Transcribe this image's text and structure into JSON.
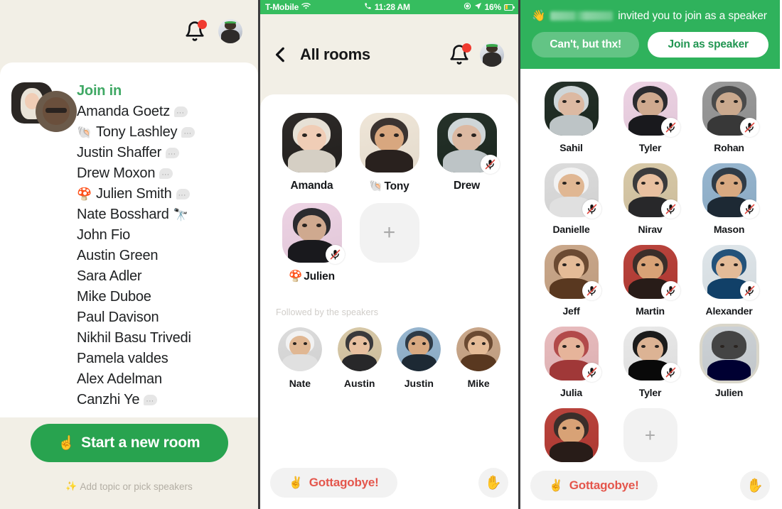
{
  "left_panel": {
    "header": {
      "notifications_icon": "bell-icon",
      "has_unread_badge": true,
      "profile_icon": "user-avatar"
    },
    "room_card": {
      "join_label": "Join in",
      "people": [
        {
          "emoji": "",
          "name": "Amanda Goetz",
          "has_bubble": true,
          "trailing_emoji": ""
        },
        {
          "emoji": "🐚",
          "name": "Tony Lashley",
          "has_bubble": true,
          "trailing_emoji": ""
        },
        {
          "emoji": "",
          "name": "Justin Shaffer",
          "has_bubble": true,
          "trailing_emoji": ""
        },
        {
          "emoji": "",
          "name": "Drew Moxon",
          "has_bubble": true,
          "trailing_emoji": ""
        },
        {
          "emoji": "🍄",
          "name": "Julien Smith",
          "has_bubble": true,
          "trailing_emoji": ""
        },
        {
          "emoji": "",
          "name": "Nate Bosshard",
          "has_bubble": false,
          "trailing_emoji": "🔭"
        },
        {
          "emoji": "",
          "name": "John Fio",
          "has_bubble": false,
          "trailing_emoji": ""
        },
        {
          "emoji": "",
          "name": "Austin Green",
          "has_bubble": false,
          "trailing_emoji": ""
        },
        {
          "emoji": "",
          "name": "Sara Adler",
          "has_bubble": false,
          "trailing_emoji": ""
        },
        {
          "emoji": "",
          "name": "Mike Duboe",
          "has_bubble": false,
          "trailing_emoji": ""
        },
        {
          "emoji": "",
          "name": "Paul Davison",
          "has_bubble": false,
          "trailing_emoji": ""
        },
        {
          "emoji": "",
          "name": "Nikhil Basu Trivedi",
          "has_bubble": false,
          "trailing_emoji": ""
        },
        {
          "emoji": "",
          "name": "Pamela valdes",
          "has_bubble": false,
          "trailing_emoji": ""
        },
        {
          "emoji": "",
          "name": "Alex Adelman",
          "has_bubble": false,
          "trailing_emoji": ""
        },
        {
          "emoji": "",
          "name": "Canzhi Ye",
          "has_bubble": true,
          "trailing_emoji": ""
        }
      ]
    },
    "footer": {
      "start_room_emoji": "☝️",
      "start_room_label": "Start a new room",
      "hint_spark": "✨",
      "hint_label": "Add topic or pick speakers"
    }
  },
  "mid_panel": {
    "status_bar": {
      "carrier": "T-Mobile",
      "wifi_icon": "wifi-icon",
      "call_icon": "phone-icon",
      "time": "11:28 AM",
      "record_icon": "screen-record-icon",
      "location_icon": "location-arrow-icon",
      "battery_percent": "16%",
      "battery_icon": "battery-low-icon"
    },
    "header": {
      "back_icon": "chevron-left-icon",
      "title": "All rooms",
      "notifications_icon": "bell-icon",
      "profile_icon": "user-avatar"
    },
    "speakers": [
      {
        "name": "Amanda",
        "emoji": "",
        "muted": false
      },
      {
        "name": "Tony",
        "emoji": "🐚",
        "muted": false
      },
      {
        "name": "Drew",
        "emoji": "",
        "muted": true
      },
      {
        "name": "Julien",
        "emoji": "🍄",
        "muted": true
      }
    ],
    "add_speaker_label": "+",
    "followed_label": "Followed by the speakers",
    "followers": [
      {
        "name": "Nate"
      },
      {
        "name": "Austin"
      },
      {
        "name": "Justin"
      },
      {
        "name": "Mike"
      }
    ],
    "footer": {
      "leave_emoji": "✌️",
      "leave_label": "Gottagobye!",
      "hand_emoji": "✋"
    }
  },
  "right_panel": {
    "invite_banner": {
      "wave_emoji": "👋",
      "redacted_name": "",
      "message": "invited you to join as a speaker",
      "decline_label": "Can't, but thx!",
      "accept_label": "Join as speaker"
    },
    "participants": [
      {
        "name": "Sahil",
        "muted": false,
        "speaking": false
      },
      {
        "name": "Tyler",
        "muted": true,
        "speaking": false
      },
      {
        "name": "Rohan",
        "muted": true,
        "speaking": false
      },
      {
        "name": "Danielle",
        "muted": true,
        "speaking": false
      },
      {
        "name": "Nirav",
        "muted": true,
        "speaking": false
      },
      {
        "name": "Mason",
        "muted": true,
        "speaking": false
      },
      {
        "name": "Jeff",
        "muted": true,
        "speaking": false
      },
      {
        "name": "Martin",
        "muted": true,
        "speaking": false
      },
      {
        "name": "Alexander",
        "muted": true,
        "speaking": false
      },
      {
        "name": "Julia",
        "muted": true,
        "speaking": false
      },
      {
        "name": "Tyler",
        "muted": true,
        "speaking": false
      },
      {
        "name": "Julien",
        "muted": false,
        "speaking": true
      }
    ],
    "add_participant_label": "+",
    "footer": {
      "leave_emoji": "✌️",
      "leave_label": "Gottagobye!",
      "hand_emoji": "✋"
    }
  },
  "colors": {
    "brand_green": "#28a34f",
    "status_bar_green": "#36bd5f",
    "banner_green": "#2fb25c",
    "beige_bg": "#f2efe6",
    "card_white": "#ffffff",
    "leave_red": "#e4564c",
    "badge_red": "#f03a2f",
    "divider_gray": "#3b3b3d"
  }
}
